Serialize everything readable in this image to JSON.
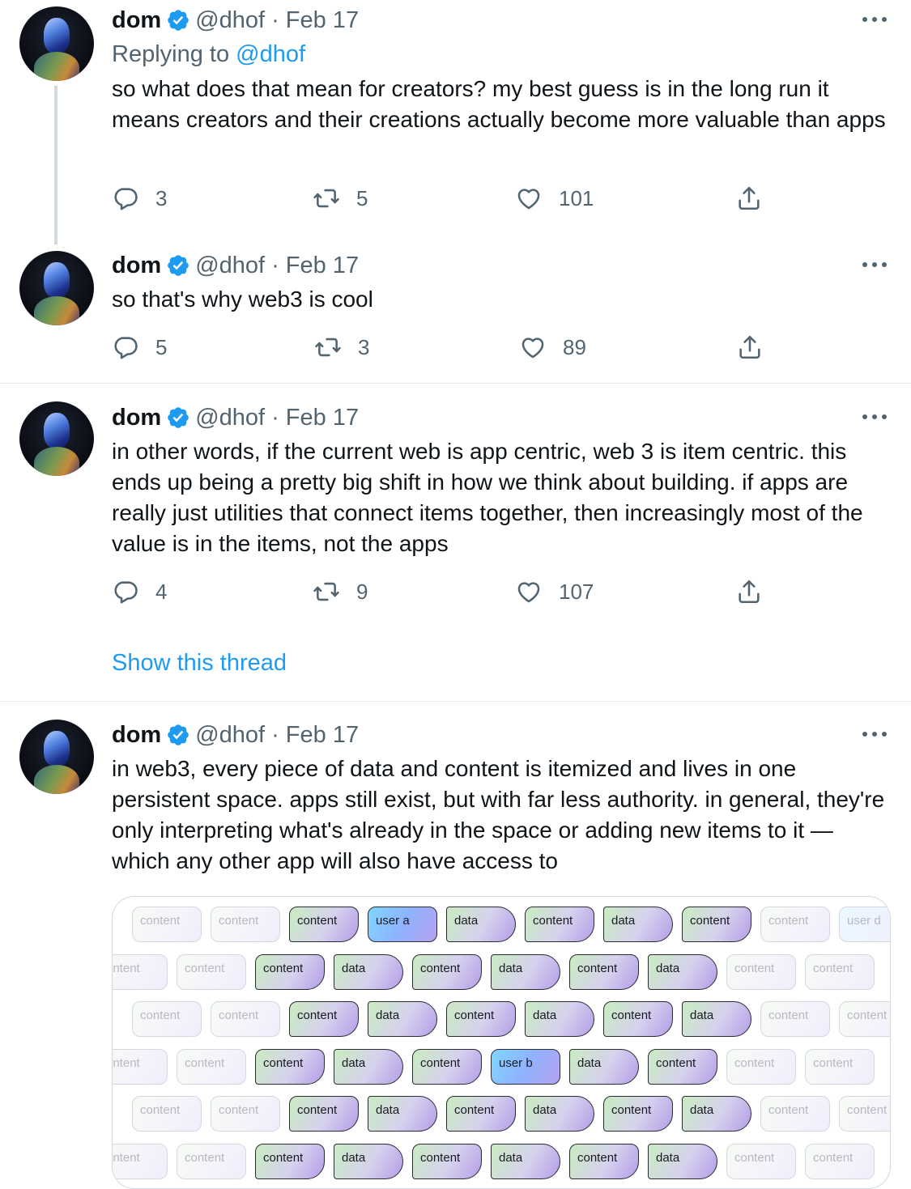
{
  "tweets": [
    {
      "name": "dom",
      "handle": "@dhof",
      "sep": "·",
      "date": "Feb 17",
      "replying_prefix": "Replying to ",
      "replying_handle": "@dhof",
      "text": "so what does that mean for creators? my best guess is in the long run it means creators and their creations actually become more valuable than apps",
      "replies": "3",
      "retweets": "5",
      "likes": "101"
    },
    {
      "name": "dom",
      "handle": "@dhof",
      "sep": "·",
      "date": "Feb 17",
      "text": "so that's why web3 is cool",
      "replies": "5",
      "retweets": "3",
      "likes": "89"
    },
    {
      "name": "dom",
      "handle": "@dhof",
      "sep": "·",
      "date": "Feb 17",
      "text": "in other words, if the current web is app centric, web 3 is item centric. this ends up being a pretty big shift in how we think about building. if apps are really just utilities that connect items together, then increasingly most of the value is in the items, not the apps",
      "replies": "4",
      "retweets": "9",
      "likes": "107",
      "show_thread": "Show this thread"
    },
    {
      "name": "dom",
      "handle": "@dhof",
      "sep": "·",
      "date": "Feb 17",
      "text": "in web3, every piece of data and content is itemized and lives in one persistent space. apps still exist, but with far less authority. in general, they're only interpreting what's already in the space or adding new items to it — which any other app will also have access to"
    }
  ],
  "media_grid": {
    "rows": [
      [
        {
          "t": "content",
          "k": "faded"
        },
        {
          "t": "content",
          "k": "faded"
        },
        {
          "t": "content",
          "k": "content"
        },
        {
          "t": "user a",
          "k": "user"
        },
        {
          "t": "data",
          "k": "data"
        },
        {
          "t": "content",
          "k": "content"
        },
        {
          "t": "data",
          "k": "data"
        },
        {
          "t": "content",
          "k": "content"
        },
        {
          "t": "content",
          "k": "faded"
        },
        {
          "t": "user d",
          "k": "user-faded"
        }
      ],
      [
        {
          "t": "ontent",
          "k": "faded"
        },
        {
          "t": "content",
          "k": "faded"
        },
        {
          "t": "content",
          "k": "content"
        },
        {
          "t": "data",
          "k": "data"
        },
        {
          "t": "content",
          "k": "content"
        },
        {
          "t": "data",
          "k": "data"
        },
        {
          "t": "content",
          "k": "content"
        },
        {
          "t": "data",
          "k": "data"
        },
        {
          "t": "content",
          "k": "faded"
        },
        {
          "t": "content",
          "k": "faded"
        }
      ],
      [
        {
          "t": "content",
          "k": "faded"
        },
        {
          "t": "content",
          "k": "faded"
        },
        {
          "t": "content",
          "k": "content"
        },
        {
          "t": "data",
          "k": "data"
        },
        {
          "t": "content",
          "k": "content"
        },
        {
          "t": "data",
          "k": "data"
        },
        {
          "t": "content",
          "k": "content"
        },
        {
          "t": "data",
          "k": "data"
        },
        {
          "t": "content",
          "k": "faded"
        },
        {
          "t": "content",
          "k": "faded"
        }
      ],
      [
        {
          "t": "ontent",
          "k": "faded"
        },
        {
          "t": "content",
          "k": "faded"
        },
        {
          "t": "content",
          "k": "content"
        },
        {
          "t": "data",
          "k": "data"
        },
        {
          "t": "content",
          "k": "content"
        },
        {
          "t": "user b",
          "k": "user"
        },
        {
          "t": "data",
          "k": "data"
        },
        {
          "t": "content",
          "k": "content"
        },
        {
          "t": "content",
          "k": "faded"
        },
        {
          "t": "content",
          "k": "faded"
        }
      ],
      [
        {
          "t": "content",
          "k": "faded"
        },
        {
          "t": "content",
          "k": "faded"
        },
        {
          "t": "content",
          "k": "content"
        },
        {
          "t": "data",
          "k": "data"
        },
        {
          "t": "content",
          "k": "content"
        },
        {
          "t": "data",
          "k": "data"
        },
        {
          "t": "content",
          "k": "content"
        },
        {
          "t": "data",
          "k": "data"
        },
        {
          "t": "content",
          "k": "faded"
        },
        {
          "t": "content",
          "k": "faded"
        }
      ],
      [
        {
          "t": "ontent",
          "k": "faded"
        },
        {
          "t": "content",
          "k": "faded"
        },
        {
          "t": "content",
          "k": "content"
        },
        {
          "t": "data",
          "k": "data"
        },
        {
          "t": "content",
          "k": "content"
        },
        {
          "t": "data",
          "k": "data"
        },
        {
          "t": "content",
          "k": "content"
        },
        {
          "t": "data",
          "k": "data"
        },
        {
          "t": "content",
          "k": "faded"
        },
        {
          "t": "content",
          "k": "faded"
        }
      ]
    ]
  },
  "colors": {
    "link": "#1d9bf0",
    "muted": "#536471",
    "text": "#0f1419",
    "verified": "#1d9bf0"
  }
}
